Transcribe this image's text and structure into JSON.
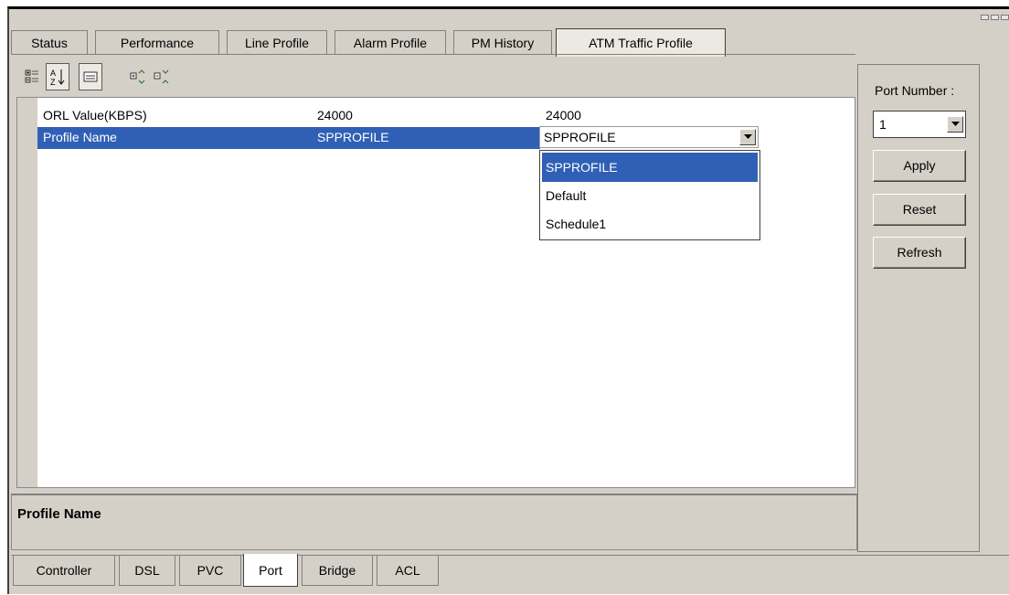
{
  "top_tabs": [
    {
      "label": "Status",
      "active": false
    },
    {
      "label": "Performance",
      "active": false
    },
    {
      "label": "Line Profile",
      "active": false
    },
    {
      "label": "Alarm Profile",
      "active": false
    },
    {
      "label": "PM History",
      "active": false
    },
    {
      "label": "ATM Traffic Profile",
      "active": true
    }
  ],
  "toolbar": {
    "buttons": [
      "categorized-view-icon",
      "sort-alphabetical-icon",
      "description-toggle-icon",
      "expand-all-icon",
      "collapse-all-icon"
    ]
  },
  "properties": {
    "rows": [
      {
        "name": "ORL Value(KBPS)",
        "value": "24000",
        "new_value": "24000"
      },
      {
        "name": "Profile Name",
        "value": "SPPROFILE",
        "new_value": "SPPROFILE"
      }
    ],
    "selected_row": 1
  },
  "profile_dropdown": {
    "options": [
      "SPPROFILE",
      "Default",
      "Schedule1"
    ],
    "selected": "SPPROFILE"
  },
  "description": {
    "title": "Profile Name"
  },
  "side_panel": {
    "port_label": "Port Number :",
    "port_value": "1",
    "apply_label": "Apply",
    "reset_label": "Reset",
    "refresh_label": "Refresh"
  },
  "bottom_tabs": [
    {
      "label": "Controller",
      "active": false
    },
    {
      "label": "DSL",
      "active": false
    },
    {
      "label": "PVC",
      "active": false
    },
    {
      "label": "Port",
      "active": true
    },
    {
      "label": "Bridge",
      "active": false
    },
    {
      "label": "ACL",
      "active": false
    }
  ],
  "colors": {
    "selection": "#3060b5",
    "panel": "#d4d0c8"
  }
}
